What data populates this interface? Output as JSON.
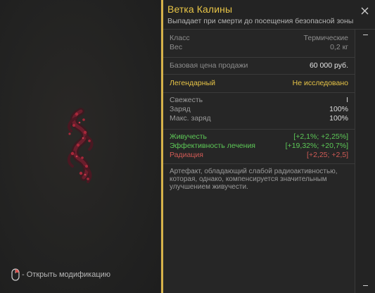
{
  "item": {
    "title": "Ветка Калины",
    "subtitle": "Выпадает при смерти до посещения безопасной зоны"
  },
  "info": {
    "class_label": "Класс",
    "class_value": "Термические",
    "weight_label": "Вес",
    "weight_value": "0,2 кг"
  },
  "price": {
    "label": "Базовая цена продажи",
    "value": "60 000 руб."
  },
  "rarity": {
    "label": "Легендарный",
    "status": "Не исследовано"
  },
  "stats": {
    "freshness_label": "Свежесть",
    "freshness_value": "I",
    "charge_label": "Заряд",
    "charge_value": "100%",
    "max_charge_label": "Макс. заряд",
    "max_charge_value": "100%"
  },
  "effects": [
    {
      "label": "Живучесть",
      "value": "[+2,1%; +2,25%]",
      "type": "positive"
    },
    {
      "label": "Эффективность лечения",
      "value": "[+19,32%; +20,7%]",
      "type": "positive"
    },
    {
      "label": "Радиация",
      "value": "[+2,25; +2,5]",
      "type": "negative"
    }
  ],
  "description": "Артефакт, обладающий слабой радиоактивностью, которая, однако, компенсируется значительным улучшением живучести.",
  "hint": {
    "text": "- Открыть модификацию",
    "icon": "mouse-icon"
  },
  "colors": {
    "accent": "#e8c547",
    "positive": "#5dc957",
    "negative": "#cf5a55",
    "panel_bg": "#262626"
  }
}
